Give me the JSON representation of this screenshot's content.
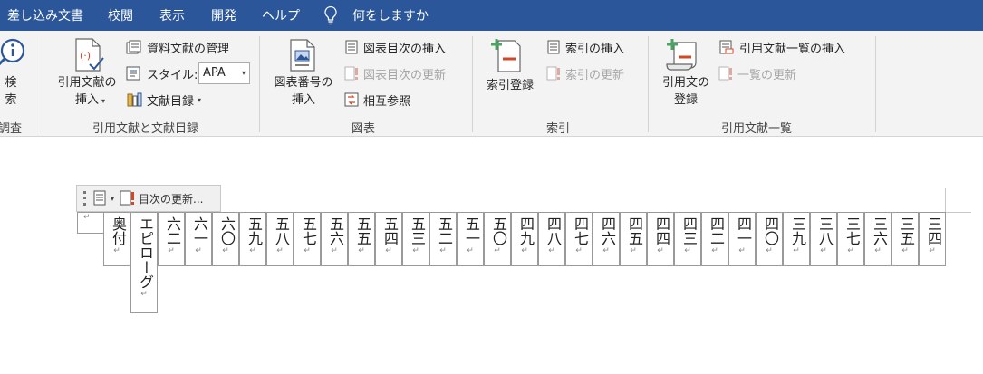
{
  "tabs": [
    "差し込み文書",
    "校閲",
    "表示",
    "開発",
    "ヘルプ"
  ],
  "tell_me": "何をしますか",
  "ribbon": {
    "search_partial": {
      "label": "検\n索",
      "group": "調査"
    },
    "citations_group": {
      "label": "引用文献と文献目録",
      "insert_citation": "引用文献の\n挿入",
      "manage_sources": "資料文献の管理",
      "style_label": "スタイル:",
      "style_value": "APA",
      "bibliography": "文献目録"
    },
    "captions_group": {
      "label": "図表",
      "insert_caption": "図表番号の\n挿入",
      "insert_table_of_figures": "図表目次の挿入",
      "update_table": "図表目次の更新",
      "cross_reference": "相互参照"
    },
    "index_group": {
      "label": "索引",
      "mark_entry": "索引登録",
      "insert_index": "索引の挿入",
      "update_index": "索引の更新"
    },
    "toa_group": {
      "label": "引用文献一覧",
      "mark_citation": "引用文の\n登録",
      "insert_toa": "引用文献一覧の挿入",
      "update_toa": "一覧の更新"
    }
  },
  "toc_control": {
    "update_label": "目次の更新..."
  },
  "toc_cells": [
    "奥付",
    "エピローグ",
    "六二",
    "六一",
    "六〇",
    "五九",
    "五八",
    "五七",
    "五六",
    "五五",
    "五四",
    "五三",
    "五二",
    "五一",
    "五〇",
    "四九",
    "四八",
    "四七",
    "四六",
    "四五",
    "四四",
    "四三",
    "四二",
    "四一",
    "四〇",
    "三九",
    "三八",
    "三七",
    "三六",
    "三五",
    "三四"
  ],
  "colors": {
    "accent": "#2b579a",
    "ribbon_bg": "#f3f3f3",
    "add_green": "#4aa564",
    "minus_red": "#d24726"
  }
}
